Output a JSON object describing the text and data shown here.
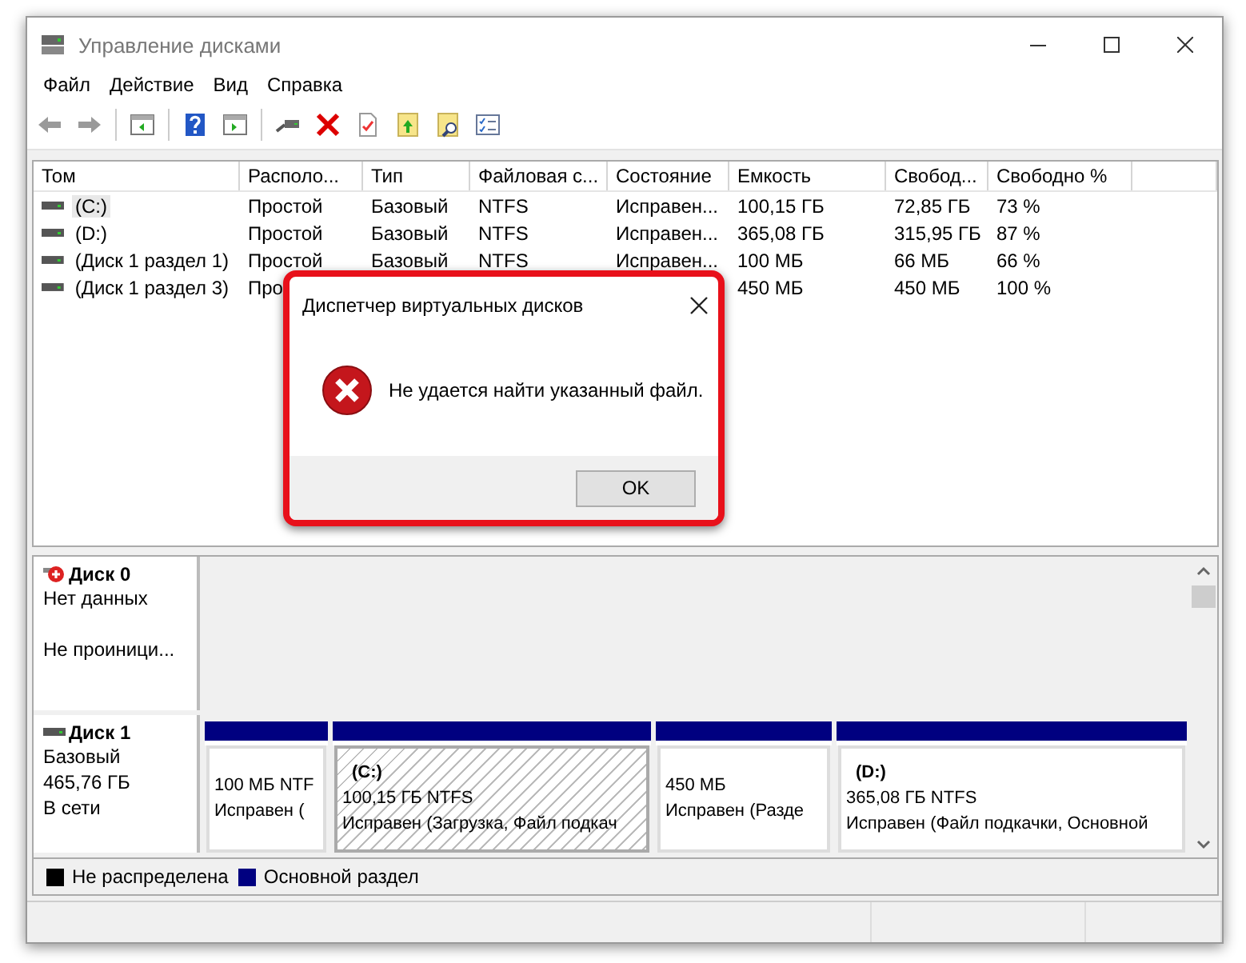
{
  "window": {
    "title": "Управление дисками"
  },
  "menu": [
    "Файл",
    "Действие",
    "Вид",
    "Справка"
  ],
  "volume_table": {
    "columns": [
      "Том",
      "Располо...",
      "Тип",
      "Файловая с...",
      "Состояние",
      "Емкость",
      "Свобод...",
      "Свободно %"
    ],
    "rows": [
      {
        "selected": true,
        "cells": [
          "(C:)",
          "Простой",
          "Базовый",
          "NTFS",
          "Исправен...",
          "100,15 ГБ",
          "72,85 ГБ",
          "73 %"
        ]
      },
      {
        "selected": false,
        "cells": [
          "(D:)",
          "Простой",
          "Базовый",
          "NTFS",
          "Исправен...",
          "365,08 ГБ",
          "315,95 ГБ",
          "87 %"
        ]
      },
      {
        "selected": false,
        "cells": [
          "(Диск 1 раздел 1)",
          "Простой",
          "Базовый",
          "NTFS",
          "Исправен...",
          "100 МБ",
          "66 МБ",
          "66 %"
        ]
      },
      {
        "selected": false,
        "cells": [
          "(Диск 1 раздел 3)",
          "Про",
          null,
          null,
          null,
          "450 МБ",
          "450 МБ",
          "100 %"
        ]
      }
    ]
  },
  "disks": [
    {
      "name": "Диск 0",
      "kind": "error",
      "info": [
        "Нет данных"
      ],
      "status": "Не проиници..."
    },
    {
      "name": "Диск 1",
      "kind": "basic",
      "info": [
        "Базовый",
        "465,76 ГБ",
        "В сети"
      ],
      "partitions": [
        {
          "size": "100 МБ NTF",
          "status": "Исправен (",
          "selected": false
        },
        {
          "label": "(C:)",
          "size": "100,15 ГБ NTFS",
          "status": "Исправен (Загрузка, Файл подкач",
          "selected": true
        },
        {
          "size": "450 МБ",
          "status": "Исправен (Разде",
          "selected": false
        },
        {
          "label": "(D:)",
          "size": "365,08 ГБ NTFS",
          "status": "Исправен (Файл подкачки, Основной",
          "selected": false
        }
      ]
    }
  ],
  "legend": [
    {
      "label": "Не распределена",
      "color": "#000000"
    },
    {
      "label": "Основной раздел",
      "color": "#000080"
    }
  ],
  "dialog": {
    "title": "Диспетчер виртуальных дисков",
    "message": "Не удается найти указанный файл.",
    "button": "OK"
  }
}
